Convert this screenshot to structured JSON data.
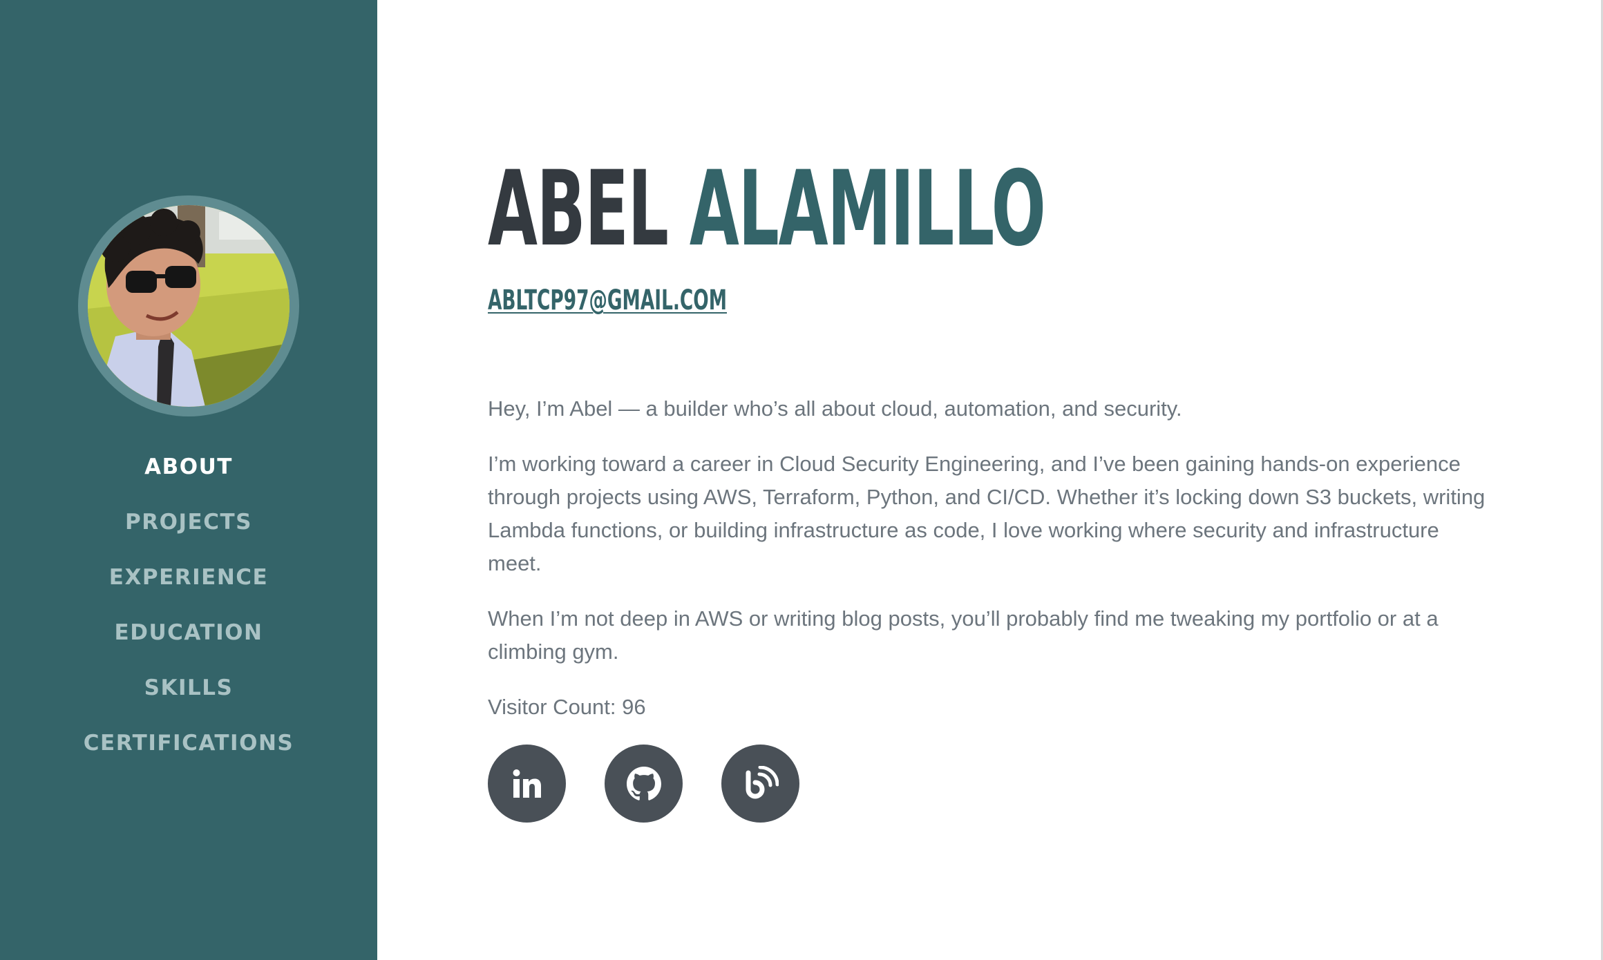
{
  "profile": {
    "first_name": "ABEL",
    "last_name": "ALAMILLO",
    "email": "ABLTCP97@GMAIL.COM"
  },
  "nav": {
    "items": [
      {
        "label": "ABOUT",
        "active": true
      },
      {
        "label": "PROJECTS",
        "active": false
      },
      {
        "label": "EXPERIENCE",
        "active": false
      },
      {
        "label": "EDUCATION",
        "active": false
      },
      {
        "label": "SKILLS",
        "active": false
      },
      {
        "label": "CERTIFICATIONS",
        "active": false
      }
    ]
  },
  "about": {
    "paragraphs": [
      "Hey, I’m Abel — a builder who’s all about cloud, automation, and security.",
      "I’m working toward a career in Cloud Security Engineering, and I’ve been gaining hands-on experience through projects using AWS, Terraform, Python, and CI/CD. Whether it’s locking down S3 buckets, writing Lambda functions, or building infrastructure as code, I love working where security and infrastructure meet.",
      "When I’m not deep in AWS or writing blog posts, you’ll probably find me tweaking my portfolio or at a climbing gym."
    ],
    "visitor_count": "Visitor Count: 96"
  },
  "social": {
    "icons": [
      "linkedin-icon",
      "github-icon",
      "blog-icon"
    ]
  },
  "colors": {
    "sidebar_bg": "#346469",
    "accent": "#346469",
    "name_dark": "#343a40",
    "body_text": "#6c757d",
    "social_bg": "#495057",
    "nav_inactive": "#a9c2c4",
    "nav_active": "#ffffff"
  }
}
